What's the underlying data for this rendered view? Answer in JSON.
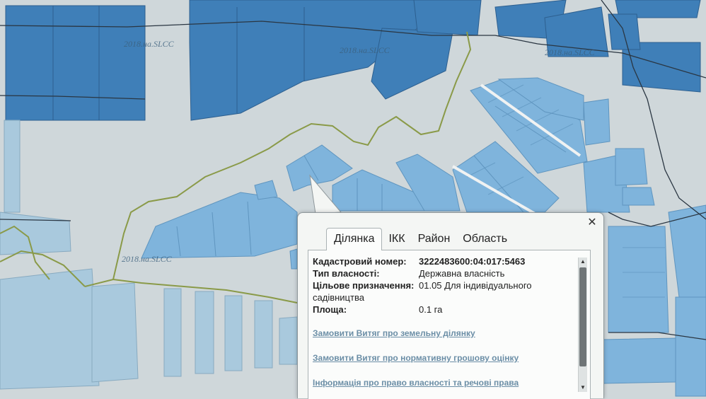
{
  "map": {
    "watermarks": [
      "2018.на.SLCC",
      "2018.на.SLCC",
      "2018.на.SLCC",
      "2018.на.SLCC"
    ],
    "colors": {
      "background": "#cfd7da",
      "parcel_dark": "#3f7fb8",
      "parcel_light": "#7fb4dc",
      "parcel_pale": "#a9c9dd",
      "boundary": "#8a9a48",
      "road": "#2a3642"
    }
  },
  "popup": {
    "close_icon": "close-icon",
    "tabs": [
      "Ділянка",
      "ІКК",
      "Район",
      "Область"
    ],
    "active_tab": "Ділянка",
    "attributes": [
      {
        "label": "Кадастровий номер:",
        "value": "3222483600:04:017:5463"
      },
      {
        "label": "Тип власності:",
        "value": "Державна власність"
      },
      {
        "label": "Цільове призначення:",
        "value": "01.05 Для індивідуального"
      },
      {
        "label": "",
        "value": "садівництва"
      },
      {
        "label": "Площа:",
        "value": "0.1 га"
      }
    ],
    "links": [
      "Замовити Витяг про земельну ділянку",
      "Замовити Витяг про нормативну грошову оцінку",
      "Інформація про право власності та речові права"
    ]
  }
}
